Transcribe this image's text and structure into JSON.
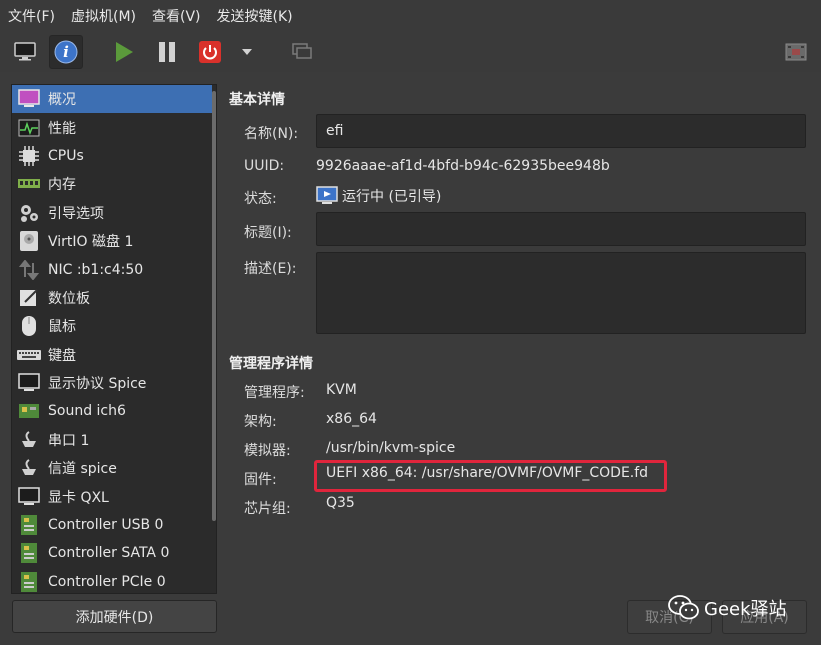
{
  "menubar": [
    "文件(F)",
    "虚拟机(M)",
    "查看(V)",
    "发送按键(K)"
  ],
  "sidebar": {
    "items": [
      {
        "label": "概况",
        "icon": "overview-monitor-icon",
        "selected": true
      },
      {
        "label": "性能",
        "icon": "performance-graph-icon"
      },
      {
        "label": "CPUs",
        "icon": "cpu-chip-icon"
      },
      {
        "label": "内存",
        "icon": "memory-module-icon"
      },
      {
        "label": "引导选项",
        "icon": "boot-gears-icon"
      },
      {
        "label": "VirtIO 磁盘 1",
        "icon": "disk-icon"
      },
      {
        "label": "NIC :b1:c4:50",
        "icon": "nic-arrows-icon"
      },
      {
        "label": "数位板",
        "icon": "tablet-pen-icon"
      },
      {
        "label": "鼠标",
        "icon": "mouse-icon"
      },
      {
        "label": "键盘",
        "icon": "keyboard-icon"
      },
      {
        "label": "显示协议 Spice",
        "icon": "display-monitor-icon"
      },
      {
        "label": "Sound ich6",
        "icon": "sound-card-icon"
      },
      {
        "label": "串口 1",
        "icon": "serial-port-icon"
      },
      {
        "label": "信道 spice",
        "icon": "channel-icon"
      },
      {
        "label": "显卡 QXL",
        "icon": "video-card-icon"
      },
      {
        "label": "Controller USB 0",
        "icon": "controller-icon"
      },
      {
        "label": "Controller SATA 0",
        "icon": "controller-icon"
      },
      {
        "label": "Controller PCIe 0",
        "icon": "controller-icon"
      }
    ],
    "add_hardware": "添加硬件(D)"
  },
  "basic": {
    "title": "基本详情",
    "name_label": "名称(N):",
    "name_value": "efi",
    "uuid_label": "UUID:",
    "uuid_value": "9926aaae-af1d-4bfd-b94c-62935bee948b",
    "status_label": "状态:",
    "status_value": "运行中 (已引导)",
    "title_label": "标题(I):",
    "title_value": "",
    "desc_label": "描述(E):",
    "desc_value": ""
  },
  "hypervisor": {
    "title": "管理程序详情",
    "rows": [
      {
        "label": "管理程序:",
        "value": "KVM"
      },
      {
        "label": "架构:",
        "value": "x86_64"
      },
      {
        "label": "模拟器:",
        "value": "/usr/bin/kvm-spice"
      },
      {
        "label": "固件:",
        "value": "UEFI x86_64: /usr/share/OVMF/OVMF_CODE.fd"
      },
      {
        "label": "芯片组:",
        "value": "Q35"
      }
    ]
  },
  "buttons": {
    "cancel": "取消(C)",
    "apply": "应用(A)"
  },
  "watermark": "Geek驿站",
  "colors": {
    "selected": "#3d6fb3",
    "highlight": "#e0253c",
    "shutdown": "#d9312b",
    "play": "#5b9a3b"
  }
}
